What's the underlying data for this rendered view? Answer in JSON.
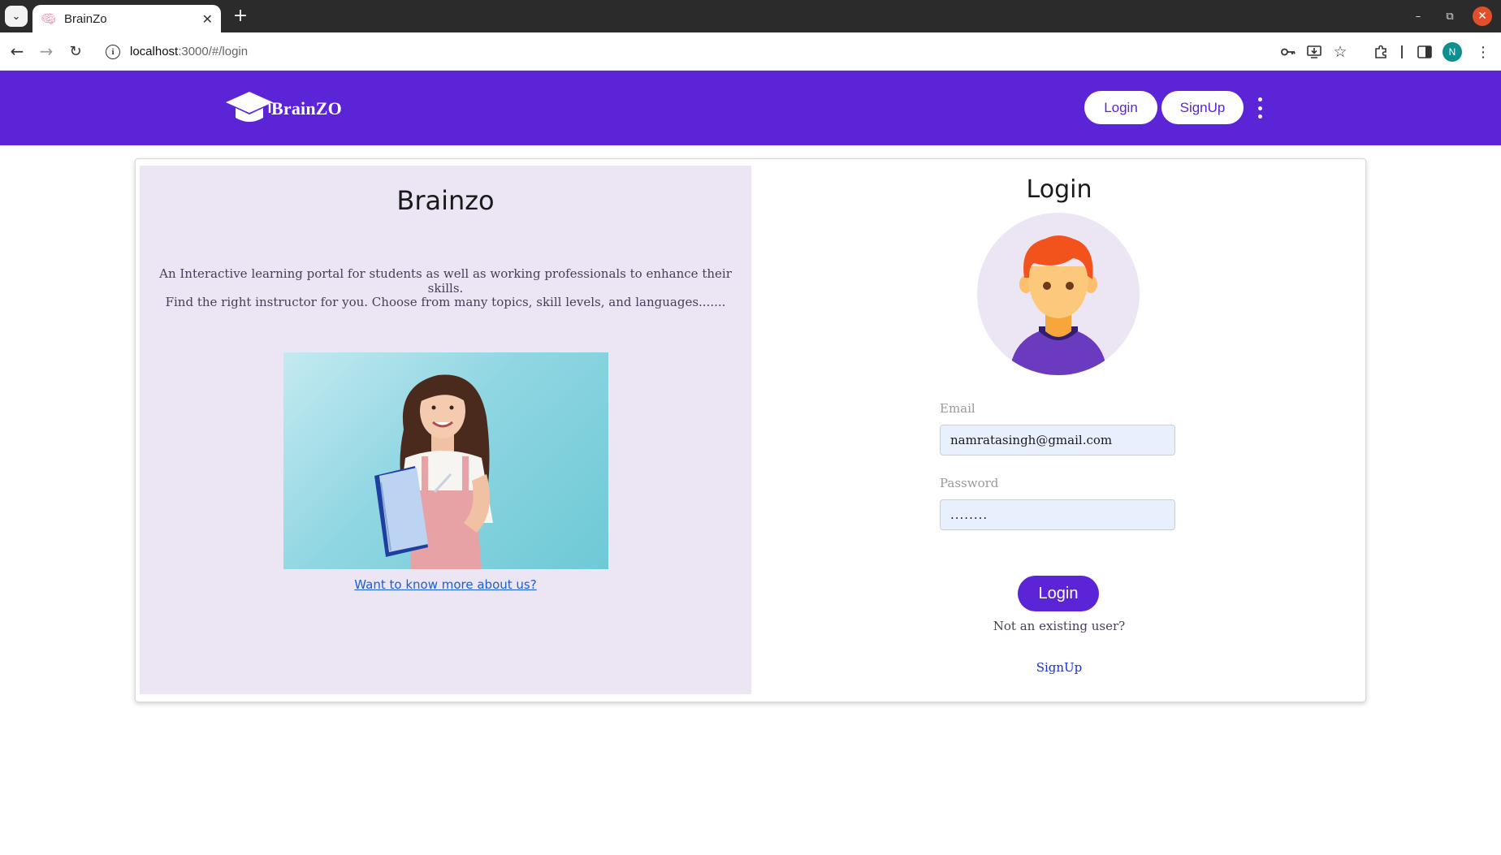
{
  "browser": {
    "tab_title": "BrainZo",
    "favicon": "brain-icon",
    "url_host": "localhost",
    "url_path": ":3000/#/login",
    "profile_initial": "N"
  },
  "header": {
    "logo_text": "BrainZO",
    "login_label": "Login",
    "signup_label": "SignUp"
  },
  "left_panel": {
    "title": "Brainzo",
    "description_line1": "An Interactive learning portal for students as well as working professionals to enhance their skills.",
    "description_line2": "Find the right instructor for you. Choose from many topics, skill levels, and languages.......",
    "about_link": "Want to know more about us?"
  },
  "login_form": {
    "title": "Login",
    "email_label": "Email",
    "email_value": "namratasingh@gmail.com",
    "password_label": "Password",
    "password_value": "........",
    "submit_label": "Login",
    "not_user_text": "Not an existing user?",
    "signup_link": "SignUp"
  },
  "colors": {
    "brand": "#5b24d7",
    "panel_bg": "#ece5f4",
    "input_bg": "#e8f0fe"
  }
}
